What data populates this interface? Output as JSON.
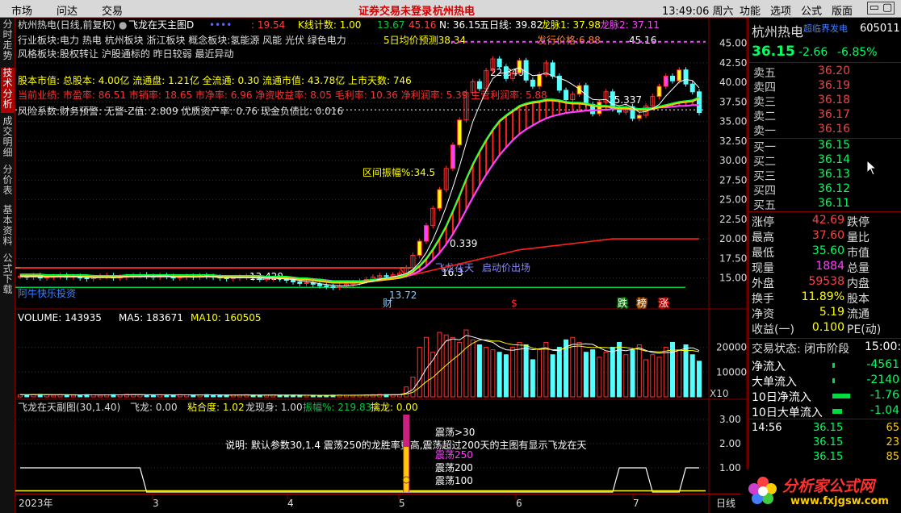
{
  "menu": {
    "market": "市场",
    "wendi": "问达",
    "trade": "交易",
    "notice": "证券交易未登录",
    "broker": "杭州热电",
    "clock": "13:49:06 周六",
    "function": "功能",
    "options": "选项",
    "formula": "公式",
    "layout": "版面"
  },
  "sidebar": {
    "tabs": [
      "分时走势",
      "技术分析",
      "成交明细",
      "分价表",
      "基本资料",
      "公式下载"
    ],
    "active": 1
  },
  "main": {
    "title": "杭州热电(日线,前复权)",
    "formula_name": "飞龙在天主图D",
    "dots_label": "••••",
    "legend": [
      "",
      ": 19.54",
      "K线计数: 1.00",
      "13.67",
      "45.16",
      "N: 36.15",
      "五日线: 39.82",
      "龙脉1: 37.98",
      "龙脉2: 37.11"
    ],
    "info": [
      "行业板块:电力 热电 杭州板块 浙江板块 概念板块:氢能源 风能 光伏 绿色电力",
      "风格板块:股权转让 沪股通标的 昨日较弱 最近异动",
      "股本市值: 总股本: 4.00亿 流通盘: 1.21亿 全流通: 0.30 流通市值: 43.78亿 上市天数: 746",
      "当前业绩: 市盈率: 86.51 市销率: 18.65 市净率: 6.96 净资收益率: 8.05 毛利率: 10.36 净利润率: 5.39 主营利润率: 5.88",
      "风险系数:财务预警: 无警-Z值: 2.809 优质资产率: 0.76 现金负债比: 0.016"
    ],
    "forecast": "5日均价预测38.34",
    "issue_price": "发行价格:6.88",
    "range_amp": "区间振幅%:34.5",
    "peak": "45.16",
    "low_label": "13.72",
    "mid_labels": [
      "22.840",
      "15.337",
      "0.339",
      "16.3",
      "13.429"
    ],
    "start_labels": [
      "飞龙在天",
      "启动价出场"
    ],
    "watermark": "阿牛快乐投资",
    "markers": [
      "财",
      "$",
      "跌",
      "榜",
      "涨"
    ]
  },
  "volume": {
    "legend": [
      "VOLUME: 143935",
      "MA5: 183671",
      "MA10: 160505"
    ],
    "x10": "X10"
  },
  "sub": {
    "legend": [
      "飞龙在天副图(30,1.40)",
      "飞龙: 0.00",
      "粘合度: 1.02",
      "龙现身: 1.00",
      "振幅%: 219.83",
      "擒龙: 0.00"
    ],
    "desc": "说明: 默认参数30,1.4 震荡250的龙胜率更高,震荡超过200天的主图有显示飞龙在天",
    "osc": [
      "震荡>30",
      "震荡250",
      "震荡200",
      "震荡100"
    ],
    "xaxis": [
      "2023年",
      "3",
      "4",
      "5",
      "6",
      "7"
    ],
    "xright": "日线"
  },
  "quote": {
    "name": "杭州热电",
    "tag": "超临界发电",
    "code": "605011",
    "price": "36.15",
    "change": "-2.66",
    "pct": "-6.85%",
    "asks": [
      {
        "l": "卖五",
        "p": "36.20"
      },
      {
        "l": "卖四",
        "p": "36.19"
      },
      {
        "l": "卖三",
        "p": "36.18"
      },
      {
        "l": "卖二",
        "p": "36.17"
      },
      {
        "l": "卖一",
        "p": "36.16"
      }
    ],
    "bids": [
      {
        "l": "买一",
        "p": "36.15"
      },
      {
        "l": "买二",
        "p": "36.14"
      },
      {
        "l": "买三",
        "p": "36.13"
      },
      {
        "l": "买四",
        "p": "36.12"
      },
      {
        "l": "买五",
        "p": "36.11"
      }
    ],
    "stats": [
      {
        "l": "涨停",
        "v": "42.69",
        "r": "跌停"
      },
      {
        "l": "最高",
        "v": "37.60",
        "r": "量比"
      },
      {
        "l": "最低",
        "v": "35.60",
        "r": "市值"
      },
      {
        "l": "现量",
        "v": "1884",
        "r": "总量"
      },
      {
        "l": "外盘",
        "v": "59538",
        "r": "内盘"
      },
      {
        "l": "换手",
        "v": "11.89%",
        "r": "股本"
      },
      {
        "l": "净资",
        "v": "5.19",
        "r": "流通"
      },
      {
        "l": "收益(一)",
        "v": "0.100",
        "r": "PE(动)"
      }
    ],
    "state_label": "交易状态: 闭市阶段",
    "state_time": "15:00:",
    "flows": [
      {
        "l": "净流入",
        "v": "-4561"
      },
      {
        "l": "大单流入",
        "v": "-2140"
      },
      {
        "l": "10日净流入",
        "v": "-1.76"
      },
      {
        "l": "10日大单流入",
        "v": "-1.04"
      }
    ],
    "ticks": [
      {
        "t": "14:56",
        "p": "36.15",
        "v": "65"
      },
      {
        "t": "",
        "p": "36.15",
        "v": "23"
      },
      {
        "t": "",
        "p": "36.15",
        "v": "85"
      }
    ]
  },
  "logo": {
    "name": "分析家公式网",
    "url": "www.fxjgsw.com"
  },
  "colors": {
    "up": "#ff3232",
    "down": "#54ffff",
    "ma_red": "#ff2020",
    "ma_white": "#ffffff",
    "yellow": "#ffff00",
    "magenta": "#ff40ff",
    "green": "#00ff40"
  },
  "chart_data": [
    {
      "type": "candlestick",
      "title": "杭州热电(日线,前复权)",
      "ylim": [
        13,
        46
      ],
      "yticks": [
        15.0,
        17.5,
        20.0,
        22.5,
        25.0,
        27.5,
        30.0,
        32.5,
        35.0,
        37.5,
        40.0,
        42.5,
        45.0
      ],
      "series": [
        {
          "name": "close",
          "values": [
            15.2,
            15.1,
            15.3,
            15.0,
            15.1,
            15.2,
            15.3,
            15.1,
            15.2,
            15.0,
            14.9,
            15.1,
            15.2,
            15.3,
            15.0,
            15.1,
            15.2,
            15.3,
            15.4,
            15.2,
            15.1,
            15.3,
            15.2,
            15.0,
            15.1,
            15.2,
            15.1,
            15.3,
            15.2,
            15.1,
            15.0,
            14.9,
            15.0,
            15.1,
            15.2,
            15.0,
            14.8,
            14.9,
            15.0,
            14.9,
            14.7,
            14.5,
            14.3,
            14.4,
            14.2,
            14.0,
            13.9,
            13.8,
            14.0,
            14.2,
            14.4,
            14.6,
            14.8,
            15.1,
            15.3,
            15.2,
            15.4,
            15.6,
            16.3,
            17.9,
            19.7,
            21.7,
            23.9,
            26.3,
            29.0,
            32.0,
            35.2,
            38.7,
            40.1,
            39.2,
            41.5,
            43.0,
            42.0,
            40.5,
            41.2,
            42.8,
            40.3,
            39.5,
            41.0,
            42.5,
            40.8,
            39.0,
            37.8,
            38.5,
            39.6,
            37.2,
            36.0,
            37.5,
            38.8,
            36.6,
            36.2,
            36.9,
            35.4,
            35.8,
            37.0,
            38.2,
            39.5,
            40.8,
            40.2,
            41.6,
            39.8,
            38.8,
            36.15
          ]
        },
        {
          "name": "龙脉1",
          "values": [
            15.3,
            15.3,
            15.3,
            15.3,
            15.2,
            15.2,
            15.2,
            15.2,
            15.2,
            15.2,
            15.2,
            15.1,
            15.1,
            15.1,
            15.1,
            15.1,
            15.2,
            15.2,
            15.2,
            15.2,
            15.2,
            15.2,
            15.2,
            15.2,
            15.2,
            15.2,
            15.2,
            15.2,
            15.2,
            15.2,
            15.1,
            15.1,
            15.1,
            15.1,
            15.1,
            15.1,
            15.1,
            15.0,
            15.0,
            15.0,
            15.0,
            14.9,
            14.8,
            14.8,
            14.7,
            14.6,
            14.5,
            14.4,
            14.4,
            14.4,
            14.4,
            14.4,
            14.5,
            14.6,
            14.7,
            14.8,
            14.9,
            15.0,
            15.3,
            15.8,
            16.5,
            17.4,
            18.6,
            20.0,
            21.6,
            23.5,
            25.5,
            27.6,
            29.5,
            31.1,
            32.6,
            33.9,
            35.0,
            35.7,
            36.3,
            36.9,
            37.2,
            37.4,
            37.5,
            37.7,
            37.7,
            37.6,
            37.4,
            37.3,
            37.3,
            37.2,
            37.0,
            36.9,
            36.9,
            36.8,
            36.7,
            36.7,
            36.6,
            36.5,
            36.5,
            36.6,
            36.8,
            37.0,
            37.2,
            37.4,
            37.5,
            37.6,
            37.98
          ]
        },
        {
          "name": "龙脉2",
          "values": [
            15.2,
            15.2,
            15.2,
            15.2,
            15.2,
            15.2,
            15.2,
            15.2,
            15.2,
            15.2,
            15.2,
            15.2,
            15.2,
            15.2,
            15.2,
            15.2,
            15.2,
            15.2,
            15.2,
            15.2,
            15.2,
            15.2,
            15.2,
            15.2,
            15.2,
            15.2,
            15.2,
            15.2,
            15.2,
            15.2,
            15.2,
            15.2,
            15.2,
            15.2,
            15.1,
            15.1,
            15.1,
            15.1,
            15.1,
            15.1,
            15.0,
            15.0,
            14.9,
            14.9,
            14.8,
            14.8,
            14.7,
            14.6,
            14.6,
            14.6,
            14.6,
            14.6,
            14.6,
            14.7,
            14.7,
            14.8,
            14.9,
            15.0,
            15.2,
            15.5,
            15.9,
            16.5,
            17.3,
            18.2,
            19.3,
            20.6,
            22.1,
            23.7,
            25.3,
            26.8,
            28.2,
            29.5,
            30.7,
            31.7,
            32.6,
            33.4,
            34.0,
            34.5,
            35.0,
            35.4,
            35.7,
            35.9,
            36.1,
            36.2,
            36.3,
            36.4,
            36.4,
            36.5,
            36.5,
            36.6,
            36.6,
            36.6,
            36.6,
            36.6,
            36.7,
            36.7,
            36.8,
            36.8,
            36.9,
            37.0,
            37.0,
            37.1,
            37.11
          ]
        },
        {
          "name": "长线",
          "values": [
            16.3,
            16.3,
            16.3,
            16.3,
            16.3,
            16.3,
            16.3,
            16.3,
            16.3,
            16.3,
            16.3,
            16.3,
            16.3,
            16.3,
            16.3,
            16.3,
            16.3,
            16.3,
            16.3,
            16.3,
            16.3,
            16.3,
            16.3,
            16.3,
            16.3,
            16.3,
            16.3,
            16.3,
            16.3,
            16.3,
            16.3,
            16.3,
            16.3,
            16.3,
            16.3,
            16.3,
            16.3,
            16.3,
            16.3,
            16.3,
            16.3,
            16.3,
            16.3,
            16.3,
            16.3,
            16.3,
            16.3,
            16.3,
            16.3,
            16.3,
            16.3,
            16.3,
            16.3,
            16.3,
            16.3,
            16.3,
            16.3,
            16.3,
            15.2,
            15.4,
            15.6,
            15.8,
            16.0,
            16.2,
            16.4,
            16.6,
            16.8,
            17.0,
            17.2,
            17.4,
            17.6,
            17.8,
            18.0,
            18.2,
            18.4,
            18.6,
            18.7,
            18.8,
            18.9,
            19.0,
            19.1,
            19.2,
            19.3,
            19.4,
            19.5,
            19.6,
            19.7,
            19.8,
            19.9,
            20.0,
            20.0,
            20.0,
            20.0,
            20.0,
            20.0,
            20.0,
            20.0,
            20.0,
            20.0,
            20.0,
            20.0,
            20.0,
            20.0
          ]
        }
      ]
    },
    {
      "type": "bar",
      "title": "VOLUME",
      "ylim": [
        0,
        28000
      ],
      "yticks": [
        10000,
        20000
      ],
      "series": [
        {
          "name": "VOLUME",
          "values": [
            900,
            800,
            900,
            1000,
            800,
            700,
            900,
            800,
            700,
            800,
            900,
            800,
            700,
            800,
            900,
            800,
            1000,
            900,
            800,
            700,
            800,
            900,
            800,
            700,
            900,
            800,
            700,
            800,
            900,
            800,
            700,
            600,
            700,
            800,
            900,
            700,
            600,
            700,
            800,
            700,
            600,
            700,
            600,
            700,
            600,
            500,
            600,
            700,
            800,
            700,
            600,
            700,
            800,
            900,
            1000,
            900,
            800,
            900,
            4000,
            8000,
            20000,
            24000,
            18000,
            26000,
            25000,
            24000,
            22000,
            27000,
            23000,
            21000,
            20000,
            19000,
            18000,
            17000,
            20000,
            22000,
            21000,
            15000,
            19000,
            22000,
            17000,
            20000,
            23000,
            24000,
            22000,
            18000,
            19000,
            16000,
            18000,
            20000,
            22000,
            17000,
            19000,
            21000,
            15000,
            17000,
            16000,
            20000,
            22000,
            19000,
            21000,
            17000,
            14394
          ]
        },
        {
          "name": "MA5",
          "values": []
        },
        {
          "name": "MA10",
          "values": []
        }
      ]
    },
    {
      "type": "line",
      "title": "飞龙在天副图(30,1.40)",
      "ylim": [
        0,
        3.2
      ],
      "yticks": [
        1.0,
        2.0,
        3.0
      ],
      "series": [
        {
          "name": "龙现身",
          "values": [
            1,
            1,
            1,
            1,
            1,
            1,
            1,
            1,
            1,
            1,
            1,
            1,
            1,
            1,
            1,
            1,
            1,
            1,
            1,
            0,
            0,
            0,
            0,
            0,
            0,
            0,
            0,
            0,
            0,
            0,
            0,
            0,
            0,
            0,
            0,
            0,
            0,
            0,
            0,
            0,
            0,
            0,
            0,
            0,
            0,
            0,
            0,
            0,
            0,
            0,
            0,
            0,
            0,
            0,
            0,
            0,
            0,
            0,
            0,
            0,
            0,
            0,
            0,
            0,
            0,
            0,
            0,
            0,
            0,
            0,
            0,
            0,
            0,
            0,
            0,
            0,
            0,
            0,
            0,
            0,
            0,
            0,
            0,
            0,
            0,
            0,
            0,
            0,
            0,
            0,
            1,
            1,
            1,
            1,
            1,
            0,
            0,
            0,
            0,
            0,
            1,
            1,
            1
          ]
        }
      ]
    }
  ]
}
